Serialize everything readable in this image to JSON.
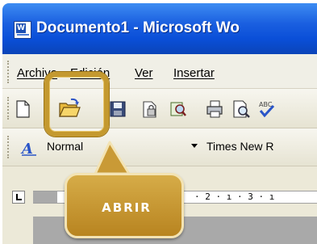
{
  "window": {
    "title": "Documento1 - Microsoft Wo"
  },
  "menubar": {
    "items": [
      {
        "label": "Archivo"
      },
      {
        "label": "Edición"
      },
      {
        "label": "Ver"
      },
      {
        "label": "Insertar"
      }
    ]
  },
  "toolbar": {
    "buttons": [
      {
        "name": "new-document"
      },
      {
        "name": "open"
      },
      {
        "name": "save"
      },
      {
        "name": "permission"
      },
      {
        "name": "search"
      },
      {
        "name": "print"
      },
      {
        "name": "print-preview"
      },
      {
        "name": "spelling"
      }
    ]
  },
  "formatting": {
    "style_value": "Normal",
    "font_value": "Times New R"
  },
  "ruler": {
    "text": "· 2 · ı · 3 · ı"
  },
  "callout": {
    "label": "ABRIR"
  },
  "colors": {
    "titlebar": "#0a4fd8",
    "highlight": "#c4992f",
    "callout": "#c99a36"
  }
}
